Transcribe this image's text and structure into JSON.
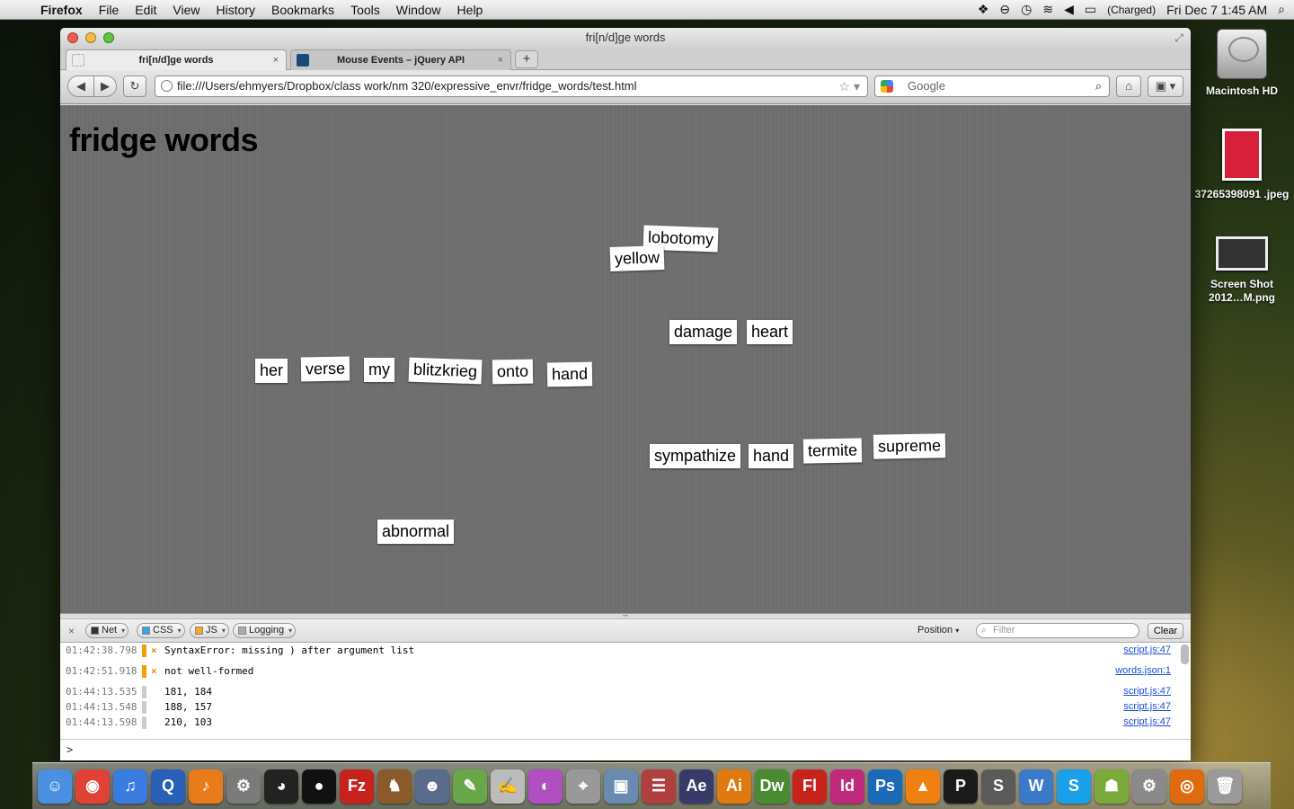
{
  "menubar": {
    "app": "Firefox",
    "items": [
      "File",
      "Edit",
      "View",
      "History",
      "Bookmarks",
      "Tools",
      "Window",
      "Help"
    ],
    "battery": "(Charged)",
    "clock": "Fri Dec 7  1:45 AM"
  },
  "desktop": {
    "icons": [
      {
        "label": "Macintosh HD"
      },
      {
        "label": "37265398091 .jpeg"
      },
      {
        "label": "Screen Shot 2012…M.png"
      }
    ]
  },
  "window": {
    "title": "fri[n/d]ge words",
    "tabs": [
      {
        "label": "fri[n/d]ge words",
        "active": true
      },
      {
        "label": "Mouse Events – jQuery API",
        "active": false
      }
    ],
    "url": "file:///Users/ehmyers/Dropbox/class work/nm 320/expressive_envr/fridge_words/test.html",
    "search_placeholder": "Google"
  },
  "page": {
    "heading": "fridge words",
    "words": [
      {
        "text": "lobotomy",
        "rotate": 2
      },
      {
        "text": "yellow",
        "rotate": -2
      },
      {
        "text": "damage",
        "rotate": 0
      },
      {
        "text": "heart",
        "rotate": 0
      },
      {
        "text": "her",
        "rotate": 0
      },
      {
        "text": "verse",
        "rotate": -1
      },
      {
        "text": "my",
        "rotate": 0
      },
      {
        "text": "blitzkrieg",
        "rotate": 2
      },
      {
        "text": "onto",
        "rotate": -1
      },
      {
        "text": "hand",
        "rotate": -1
      },
      {
        "text": "sympathize",
        "rotate": 0
      },
      {
        "text": "hand",
        "rotate": 0
      },
      {
        "text": "termite",
        "rotate": -1
      },
      {
        "text": "supreme",
        "rotate": -1
      },
      {
        "text": "abnormal",
        "rotate": 0
      }
    ]
  },
  "firebug": {
    "filters": [
      "Net",
      "CSS",
      "JS",
      "Logging"
    ],
    "position_label": "Position",
    "filter_placeholder": "Filter",
    "clear_label": "Clear",
    "log": [
      {
        "time": "01:42:38.798",
        "type": "error",
        "message": "SyntaxError: missing ) after argument list",
        "source": "script.js:47"
      },
      {
        "time": "01:42:51.918",
        "type": "error",
        "message": "not well-formed",
        "source": "words.json:1"
      },
      {
        "time": "01:44:13.535",
        "type": "log",
        "message": "181, 184",
        "source": "script.js:47"
      },
      {
        "time": "01:44:13.548",
        "type": "log",
        "message": "188, 157",
        "source": "script.js:47"
      },
      {
        "time": "01:44:13.598",
        "type": "log",
        "message": "210, 103",
        "source": "script.js:47"
      }
    ],
    "prompt": ">"
  },
  "dock": {
    "apps": [
      {
        "icon": "finder-icon",
        "color": "#4a8fe0",
        "glyph": "☺"
      },
      {
        "icon": "chrome-icon",
        "color": "#e04236",
        "glyph": "◉"
      },
      {
        "icon": "itunes-icon",
        "color": "#3a7be0",
        "glyph": "♫"
      },
      {
        "icon": "quicktime-icon",
        "color": "#2a5fb8",
        "glyph": "Q"
      },
      {
        "icon": "audacity-icon",
        "color": "#e87b1a",
        "glyph": "♪"
      },
      {
        "icon": "automator-icon",
        "color": "#7a7a7a",
        "glyph": "⚙"
      },
      {
        "icon": "eyes-icon",
        "color": "#222222",
        "glyph": "◕"
      },
      {
        "icon": "cyberduck-icon",
        "color": "#111111",
        "glyph": "●"
      },
      {
        "icon": "filezilla-icon",
        "color": "#c8221c",
        "glyph": "Fz"
      },
      {
        "icon": "sequel-icon",
        "color": "#8a5a2a",
        "glyph": "♞"
      },
      {
        "icon": "ninja-icon",
        "color": "#5a6a8a",
        "glyph": "☻"
      },
      {
        "icon": "evernote-icon",
        "color": "#6aa64a",
        "glyph": "✎"
      },
      {
        "icon": "textedit-icon",
        "color": "#bcbcbc",
        "glyph": "✍"
      },
      {
        "icon": "colorsync-icon",
        "color": "#b050c0",
        "glyph": "◐"
      },
      {
        "icon": "screenshot-icon",
        "color": "#999999",
        "glyph": "⌖"
      },
      {
        "icon": "preview-icon",
        "color": "#6a8ab0",
        "glyph": "▣"
      },
      {
        "icon": "textwrangler-icon",
        "color": "#b04040",
        "glyph": "☰"
      },
      {
        "icon": "aftereffects-icon",
        "color": "#3a3a6a",
        "glyph": "Ae"
      },
      {
        "icon": "illustrator-icon",
        "color": "#e07a10",
        "glyph": "Ai"
      },
      {
        "icon": "dreamweaver-icon",
        "color": "#4a8a30",
        "glyph": "Dw"
      },
      {
        "icon": "flash-icon",
        "color": "#c8221c",
        "glyph": "Fl"
      },
      {
        "icon": "indesign-icon",
        "color": "#c02a7a",
        "glyph": "Id"
      },
      {
        "icon": "photoshop-icon",
        "color": "#1a6ab8",
        "glyph": "Ps"
      },
      {
        "icon": "vlc-icon",
        "color": "#f08010",
        "glyph": "▲"
      },
      {
        "icon": "pixelmator-icon",
        "color": "#1a1a1a",
        "glyph": "P"
      },
      {
        "icon": "sublime-icon",
        "color": "#5a5a5a",
        "glyph": "S"
      },
      {
        "icon": "word-icon",
        "color": "#3a7ac8",
        "glyph": "W"
      },
      {
        "icon": "skype-icon",
        "color": "#1aa0e8",
        "glyph": "S"
      },
      {
        "icon": "android-icon",
        "color": "#7aaa3a",
        "glyph": "☗"
      },
      {
        "icon": "system-preferences-icon",
        "color": "#8a8a8a",
        "glyph": "⚙"
      },
      {
        "icon": "firefox-icon",
        "color": "#e06a10",
        "glyph": "◎"
      },
      {
        "icon": "trash-icon",
        "color": "#9a9a9a",
        "glyph": "🗑"
      }
    ]
  }
}
